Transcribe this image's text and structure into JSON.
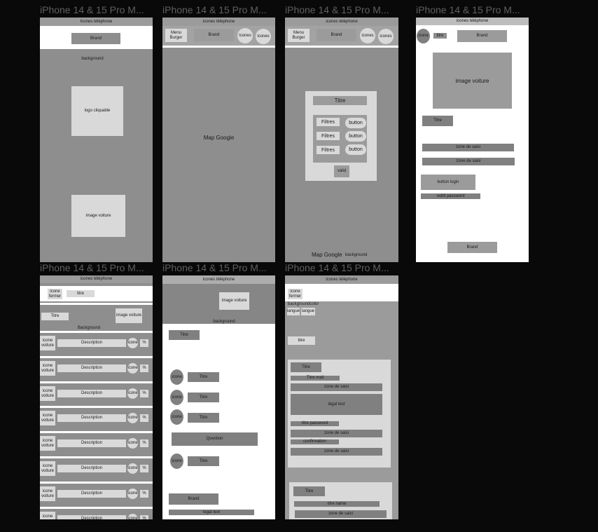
{
  "frame_title": "iPhone 14 & 15 Pro M...",
  "frame1": {
    "status": "Icones téléphone",
    "brand": "Brand",
    "background": "background",
    "logo": "logo cliquable",
    "image": "image voiture"
  },
  "frame2": {
    "status": "icones téléphone",
    "menu": "Menu Burger",
    "brand": "Brand",
    "icon1": "Icones",
    "icon2": "icones",
    "map": "Map Google"
  },
  "frame3": {
    "status": "icones téléphone",
    "menu": "Menu Burger",
    "brand": "Brand",
    "icon1": "icones",
    "icon2": "icones",
    "title": "Titre",
    "filters": [
      "Filtres",
      "Filtres",
      "Filtres"
    ],
    "buttons": [
      "button",
      "button",
      "button"
    ],
    "valid": "valid",
    "map": "Map Google",
    "background": "background"
  },
  "frame4": {
    "status": "icones téléphone",
    "icone": "icone",
    "titre_small": "titre",
    "brand": "Brand",
    "image": "image voiture",
    "titre": "Titre",
    "input1": "zone de saisi",
    "input2": "zone de saisi",
    "login": "button login",
    "forgot": "oubli password",
    "brand_bottom": "Brand"
  },
  "frame5": {
    "status": "icones téléphone",
    "close": "icone fermer",
    "titre": "titre",
    "titre2": "Titre",
    "image": "image voiture",
    "background": "Background",
    "row_icon": "icone voiture",
    "row_desc": "Description",
    "row_icone": "icone",
    "row_pct": "%"
  },
  "frame6": {
    "status": "icones téléphone",
    "image": "image voiture",
    "background": "background",
    "titre": "Titre",
    "icone": "icone",
    "items": [
      "Titre",
      "Titre",
      "Titre"
    ],
    "question": "Question",
    "last_item": "Titre",
    "brand": "Brand",
    "legal": "legal text"
  },
  "frame7": {
    "status": "icones téléphone",
    "close": "icone fermer",
    "bgcolor": "backgroundcolor",
    "langue1": "langue",
    "langue2": "langue",
    "titre": "titre",
    "form_title": "Titre",
    "mail_title": "Titre mail",
    "input": "zone de saisi",
    "legal": "légal text",
    "pwd_title": "titre password",
    "confirm": "confirmation",
    "name_title": "titre name"
  }
}
